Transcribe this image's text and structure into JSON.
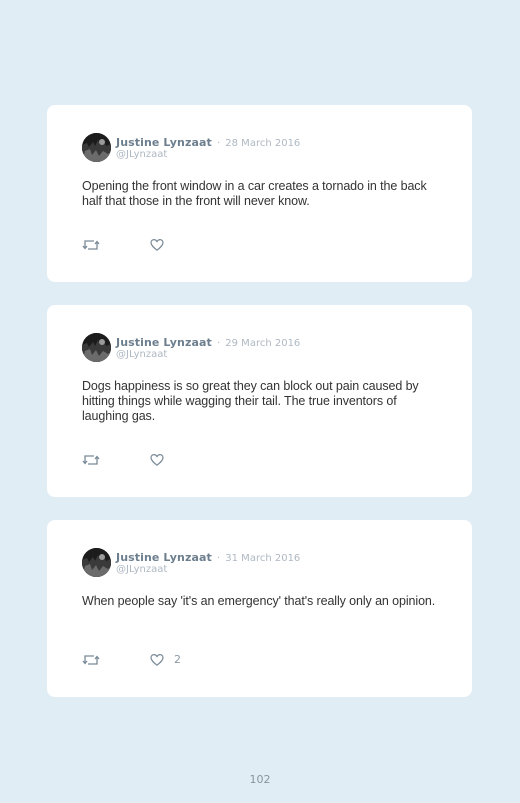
{
  "tweets": [
    {
      "name": "Justine Lynzaat",
      "separator": "·",
      "date": "28 March 2016",
      "handle": "@JLynzaat",
      "text": "Opening the front window in a car creates a tornado in the back half that those in the front will never know.",
      "like_count": ""
    },
    {
      "name": "Justine Lynzaat",
      "separator": "·",
      "date": "29 March 2016",
      "handle": "@JLynzaat",
      "text": "Dogs happiness is so great they can block out pain caused by hitting things while wagging their tail. The true inventors of laughing gas.",
      "like_count": ""
    },
    {
      "name": "Justine Lynzaat",
      "separator": "·",
      "date": "31 March 2016",
      "handle": "@JLynzaat",
      "text": "When people say 'it's an emergency' that's really only an opinion.",
      "like_count": "2"
    }
  ],
  "page_number": "102",
  "icons": {
    "retweet": "retweet-icon",
    "like": "heart-icon"
  },
  "colors": {
    "background": "#e1edf5",
    "card": "#ffffff",
    "name": "#6d7f8e",
    "meta": "#aeb8c2",
    "text": "#333333"
  }
}
